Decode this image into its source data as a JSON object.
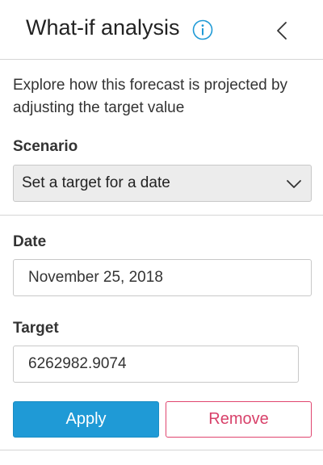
{
  "header": {
    "title": "What-if analysis",
    "info_icon": "info-circle-icon",
    "collapse_icon": "chevron-left-icon"
  },
  "description": "Explore how this forecast is projected by adjusting the target value",
  "scenario": {
    "label": "Scenario",
    "selected": "Set a target for a date"
  },
  "date": {
    "label": "Date",
    "value": "November 25, 2018"
  },
  "target": {
    "label": "Target",
    "value": "6262982.9074"
  },
  "actions": {
    "apply_label": "Apply",
    "remove_label": "Remove"
  },
  "colors": {
    "accent": "#1f9ad6",
    "danger": "#d8416a"
  }
}
